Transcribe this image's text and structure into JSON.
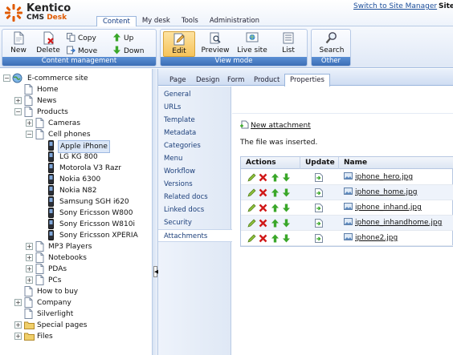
{
  "header": {
    "logo_name": "Kentico",
    "logo_product": "CMS",
    "logo_product_suffix": "Desk",
    "switch_link": "Switch to Site Manager",
    "site_label": "Site",
    "tabs": [
      {
        "label": "Content",
        "active": true
      },
      {
        "label": "My desk",
        "active": false
      },
      {
        "label": "Tools",
        "active": false
      },
      {
        "label": "Administration",
        "active": false
      }
    ]
  },
  "toolbar": {
    "content_management": {
      "label": "Content management",
      "new": "New",
      "delete": "Delete",
      "copy": "Copy",
      "move": "Move",
      "up": "Up",
      "down": "Down"
    },
    "view_mode": {
      "label": "View mode",
      "edit": "Edit",
      "preview": "Preview",
      "live_site": "Live site",
      "list": "List"
    },
    "other": {
      "label": "Other",
      "search": "Search"
    }
  },
  "tree": {
    "root": "E-commerce site",
    "nodes": [
      {
        "label": "Home"
      },
      {
        "label": "News"
      },
      {
        "label": "Products"
      },
      {
        "label": "Cameras"
      },
      {
        "label": "Cell phones"
      },
      {
        "label": "Apple iPhone",
        "selected": true
      },
      {
        "label": "LG KG 800"
      },
      {
        "label": "Motorola V3 Razr"
      },
      {
        "label": "Nokia 6300"
      },
      {
        "label": "Nokia N82"
      },
      {
        "label": "Samsung SGH i620"
      },
      {
        "label": "Sony Ericsson W800"
      },
      {
        "label": "Sony Ericsson W810i"
      },
      {
        "label": "Sony Ericsson XPERIA"
      },
      {
        "label": "MP3 Players"
      },
      {
        "label": "Notebooks"
      },
      {
        "label": "PDAs"
      },
      {
        "label": "PCs"
      },
      {
        "label": "How to buy"
      },
      {
        "label": "Company"
      },
      {
        "label": "Silverlight"
      },
      {
        "label": "Special pages"
      },
      {
        "label": "Files"
      }
    ]
  },
  "subtabs": [
    {
      "label": "Page"
    },
    {
      "label": "Design"
    },
    {
      "label": "Form"
    },
    {
      "label": "Product"
    },
    {
      "label": "Properties",
      "active": true
    }
  ],
  "properties_menu": [
    {
      "label": "General"
    },
    {
      "label": "URLs"
    },
    {
      "label": "Template"
    },
    {
      "label": "Metadata"
    },
    {
      "label": "Categories"
    },
    {
      "label": "Menu"
    },
    {
      "label": "Workflow"
    },
    {
      "label": "Versions"
    },
    {
      "label": "Related docs"
    },
    {
      "label": "Linked docs"
    },
    {
      "label": "Security"
    },
    {
      "label": "Attachments",
      "active": true
    }
  ],
  "attachments": {
    "new_attachment": "New attachment",
    "message": "The file was inserted.",
    "columns": {
      "actions": "Actions",
      "update": "Update",
      "name": "Name"
    },
    "files": [
      {
        "name": "iphone_hero.jpg"
      },
      {
        "name": "iphone_home.jpg"
      },
      {
        "name": "iphone_inhand.jpg"
      },
      {
        "name": "iphone_inhandhome.jpg"
      },
      {
        "name": "iphone2.jpg"
      }
    ]
  },
  "colors": {
    "brand_orange": "#e05a00",
    "accent_blue": "#3c6eb6",
    "link_blue": "#1c4e9a",
    "edit_active": "#f6c35a"
  }
}
